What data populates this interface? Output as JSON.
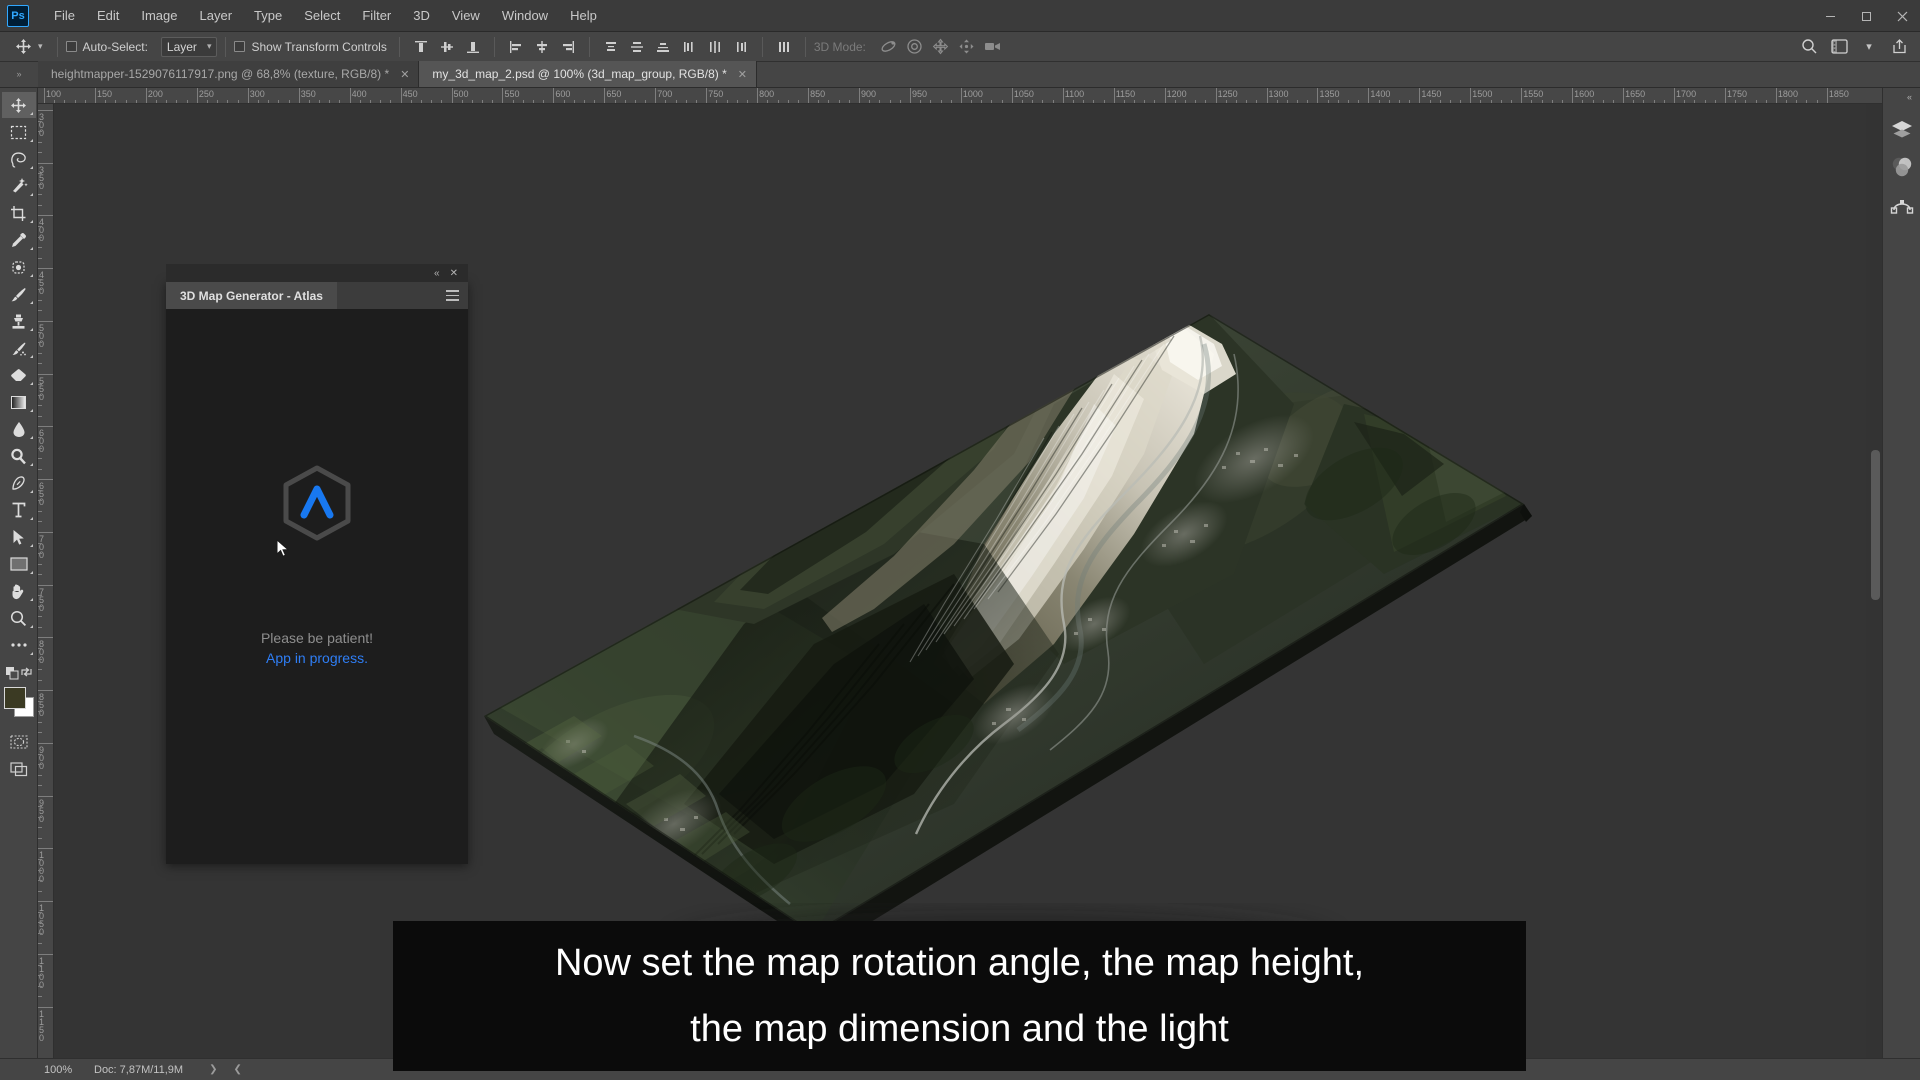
{
  "window": {
    "app_logo": "ps-logo",
    "controls": [
      {
        "name": "minimize-button",
        "glyph": "—"
      },
      {
        "name": "maximize-button",
        "glyph": "▢"
      },
      {
        "name": "close-button",
        "glyph": "✕"
      }
    ]
  },
  "menubar": {
    "items": [
      "File",
      "Edit",
      "Image",
      "Layer",
      "Type",
      "Select",
      "Filter",
      "3D",
      "View",
      "Window",
      "Help"
    ]
  },
  "options_bar": {
    "tool_icon": "move-tool-icon",
    "auto_select_label": "Auto-Select:",
    "auto_select_checked": false,
    "layer_select_value": "Layer",
    "show_transform_label": "Show Transform Controls",
    "show_transform_checked": false,
    "mode_3d_label": "3D Mode:",
    "align_icons": [
      "align-top-edges-icon",
      "align-vertical-centers-icon",
      "align-bottom-edges-icon",
      "align-left-edges-icon",
      "align-horizontal-centers-icon",
      "align-right-edges-icon"
    ],
    "distribute_icons": [
      "distribute-top-edges-icon",
      "distribute-vertical-centers-icon",
      "distribute-bottom-edges-icon",
      "distribute-left-edges-icon",
      "distribute-horizontal-centers-icon",
      "distribute-right-edges-icon"
    ],
    "extra_icon": "distribute-spacing-icon",
    "mode_3d_icons": [
      "orbit-3d-icon",
      "roll-3d-icon",
      "pan-3d-icon",
      "slide-3d-icon",
      "scale-3d-icon"
    ],
    "right_icons": [
      "search-icon",
      "workspace-icon",
      "chevron-down-icon",
      "share-icon"
    ]
  },
  "tabs": [
    {
      "label": "heightmapper-1529076117917.png @ 68,8% (texture, RGB/8) *",
      "active": false,
      "close": "✕"
    },
    {
      "label": "my_3d_map_2.psd @ 100% (3d_map_group, RGB/8) *",
      "active": true,
      "close": "✕"
    }
  ],
  "toolbar": {
    "tools": [
      {
        "name": "move-tool",
        "active": true
      },
      {
        "name": "rectangular-marquee-tool",
        "active": false
      },
      {
        "name": "lasso-tool",
        "active": false
      },
      {
        "name": "magic-wand-tool",
        "active": false
      },
      {
        "name": "crop-tool",
        "active": false
      },
      {
        "name": "eyedropper-tool",
        "active": false
      },
      {
        "name": "spot-healing-brush-tool",
        "active": false
      },
      {
        "name": "brush-tool",
        "active": false
      },
      {
        "name": "clone-stamp-tool",
        "active": false
      },
      {
        "name": "history-brush-tool",
        "active": false
      },
      {
        "name": "eraser-tool",
        "active": false
      },
      {
        "name": "gradient-tool",
        "active": false
      },
      {
        "name": "blur-tool",
        "active": false
      },
      {
        "name": "dodge-tool",
        "active": false
      },
      {
        "name": "pen-tool",
        "active": false
      },
      {
        "name": "type-tool",
        "active": false
      },
      {
        "name": "path-selection-tool",
        "active": false
      },
      {
        "name": "rectangle-tool",
        "active": false
      },
      {
        "name": "hand-tool",
        "active": false
      },
      {
        "name": "zoom-tool",
        "active": false
      },
      {
        "name": "edit-toolbar-tool",
        "active": false
      }
    ],
    "foreground_color": "#3b3a23",
    "background_color": "#ffffff",
    "quick_mask": "quick-mask-icon",
    "screen_mode": "screen-mode-icon"
  },
  "rulers": {
    "horizontal_start": 100,
    "horizontal_step": 50,
    "horizontal_end": 1850,
    "vertical_start": 300,
    "vertical_step": 50,
    "vertical_end": 1150,
    "unit": "px"
  },
  "plugin_panel": {
    "title": "3D Map Generator - Atlas",
    "collapse_glyph": "«",
    "close_glyph": "✕",
    "menu_icon": "hamburger-menu-icon",
    "logo": "atlas-hexagon-logo",
    "message_line1": "Please be patient!",
    "message_line2": "App in progress.",
    "accent_color": "#2f7ef5"
  },
  "right_dock": {
    "collapse_glyph": "«",
    "buttons": [
      "layers-panel-icon",
      "adjustments-panel-icon",
      "paths-panel-icon"
    ]
  },
  "statusbar": {
    "zoom": "100%",
    "doc_info": "Doc: 7,87M/11,9M",
    "arrow_right": "❯",
    "arrow_left": "❮"
  },
  "caption": {
    "line1": "Now set the map rotation angle, the map height,",
    "line2": "the map dimension and the light",
    "background": "#0b0b0b",
    "text_color": "#ffffff"
  },
  "canvas": {
    "document_name": "my_3d_map_2.psd",
    "content_description": "3d-terrain-map-render",
    "background": "#343434"
  }
}
